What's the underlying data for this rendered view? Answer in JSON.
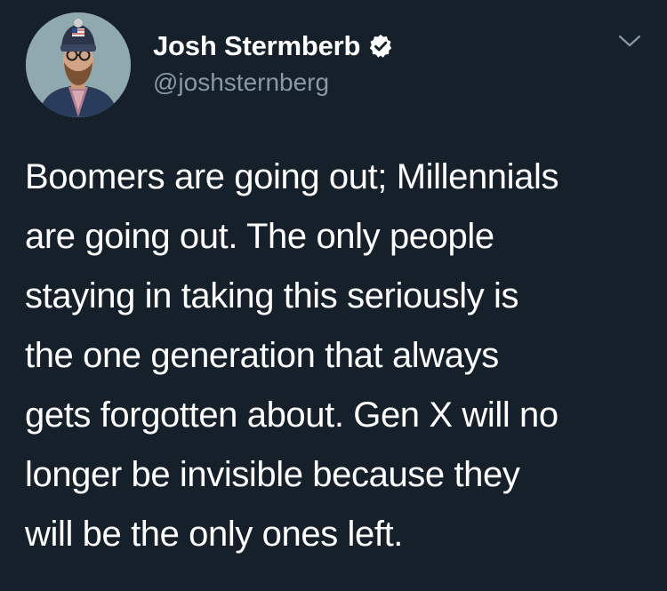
{
  "tweet": {
    "author": {
      "display_name": "Josh Stermberb",
      "handle": "@joshsternberg",
      "verified": true
    },
    "text_lines": [
      "Boomers are going out; Millennials",
      "are going out. The only people",
      "staying in taking this seriously is",
      "the one generation that always",
      "gets forgotten about. Gen X will no",
      "longer be invisible because they",
      "will be the only ones left."
    ]
  },
  "icons": {
    "verified": "verified-badge-icon",
    "menu": "chevron-down-icon"
  },
  "colors": {
    "background": "#15202b",
    "text_primary": "#ffffff",
    "text_secondary": "#8899a6",
    "verified_badge": "#ffffff"
  }
}
